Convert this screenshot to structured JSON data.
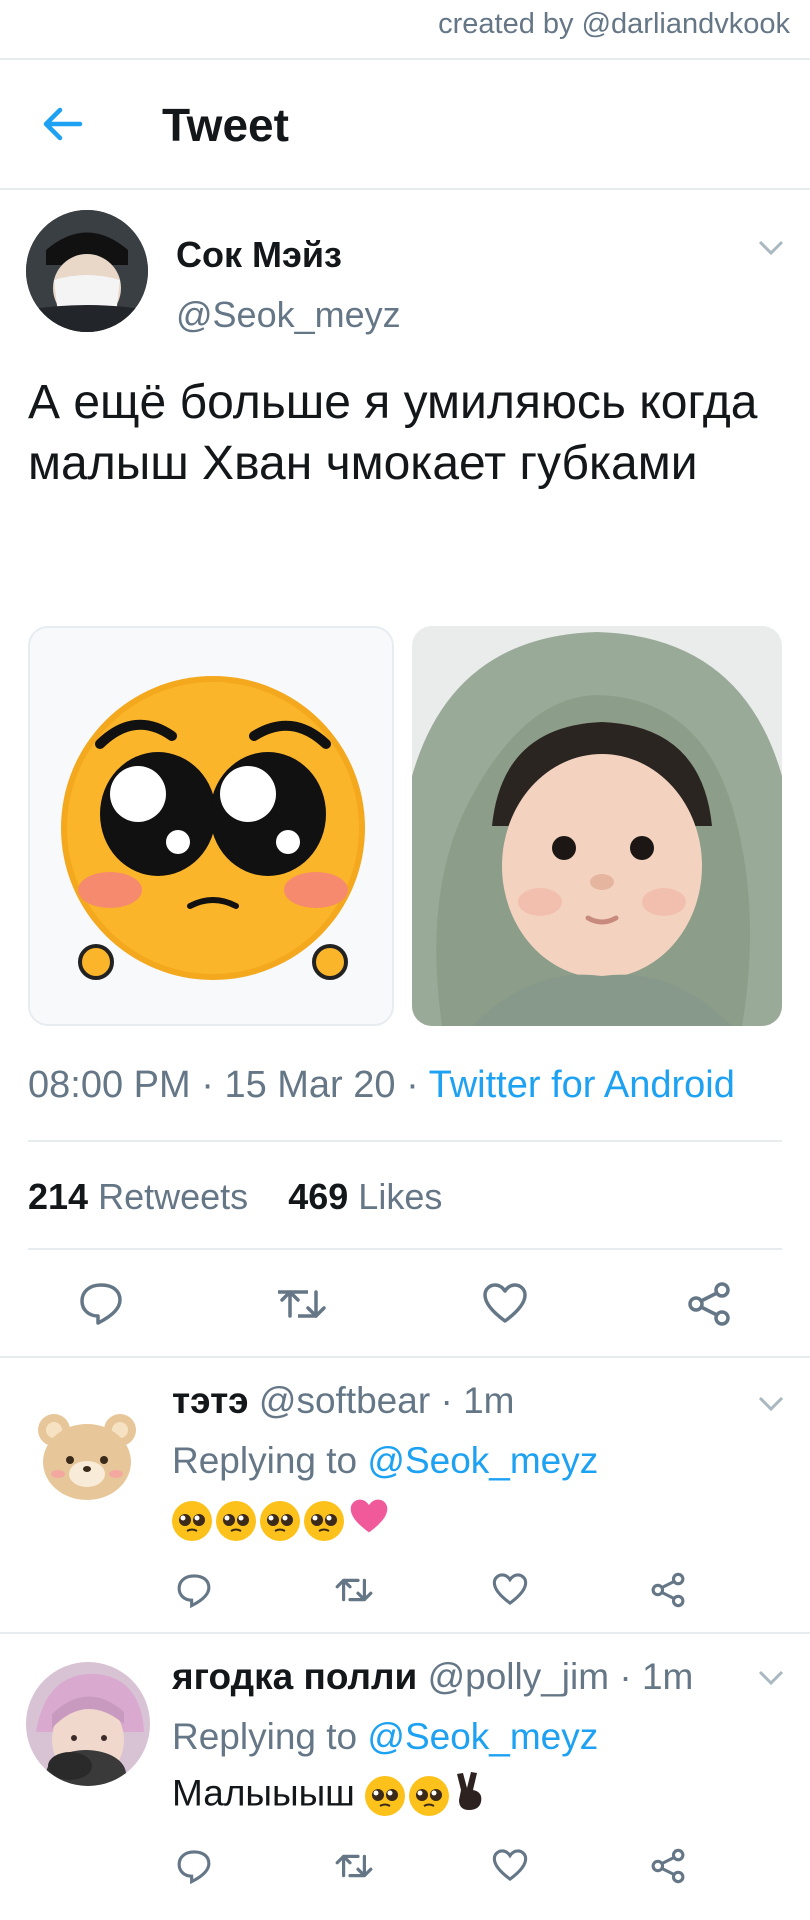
{
  "watermark": "created by @darliandvkook",
  "header": {
    "title": "Tweet"
  },
  "tweet": {
    "author_name": "Сок Мэйз",
    "author_handle": "@Seok_meyz",
    "text": "А ещё больше я умиляюсь когда малыш Хван чмокает губками",
    "time": "08:00 PM",
    "date": "15 Mar 20",
    "source": "Twitter for Android",
    "retweets_count": "214",
    "retweets_label": "Retweets",
    "likes_count": "469",
    "likes_label": "Likes"
  },
  "replies": [
    {
      "name": "тэтэ",
      "handle": "@softbear",
      "time": "1m",
      "replying_label": "Replying to",
      "replying_handle": "@Seok_meyz",
      "text": ""
    },
    {
      "name": "ягодка полли",
      "handle": "@polly_jim",
      "time": "1m",
      "replying_label": "Replying to",
      "replying_handle": "@Seok_meyz",
      "text": "Малыыыш"
    }
  ],
  "icons": [
    "back-arrow-icon",
    "caret-down-icon",
    "reply-icon",
    "retweet-icon",
    "like-icon",
    "share-icon"
  ],
  "colors": {
    "accent": "#1da1f2",
    "muted": "#657786",
    "divider": "#e6ecf0"
  }
}
